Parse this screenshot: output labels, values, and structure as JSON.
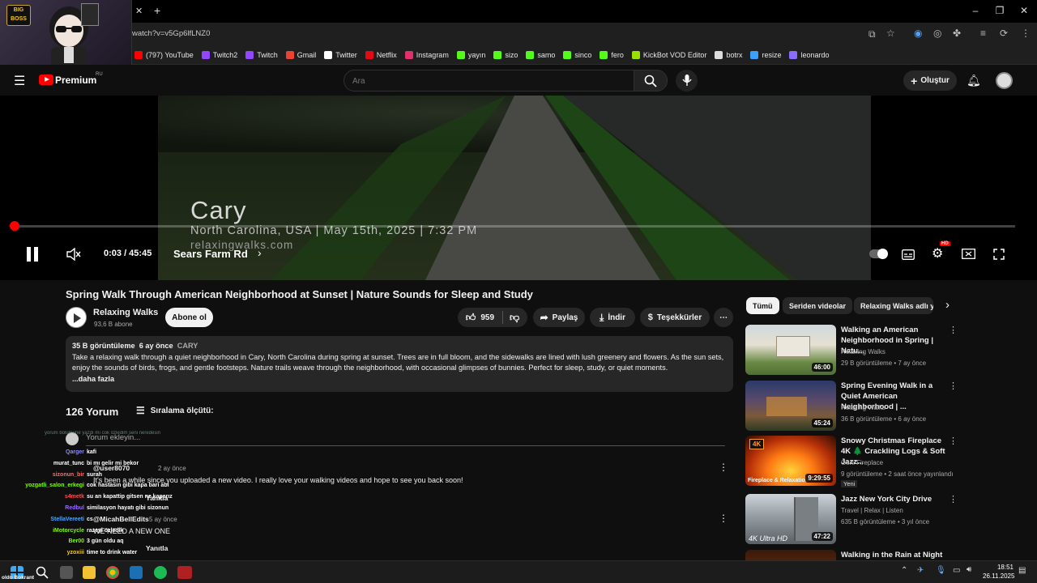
{
  "browser": {
    "url": "watch?v=v5Gp6lfLNZ0",
    "bookmarks": [
      "(797) YouTube",
      "Twitch2",
      "Twitch",
      "Gmail",
      "Twitter",
      "Netflix",
      "Instagram",
      "yayın",
      "sizo",
      "samo",
      "sinco",
      "fero",
      "KickBot VOD Editor",
      "botrx",
      "resize",
      "leonardo"
    ]
  },
  "webcam": {
    "badge_top": "BIG",
    "badge_bottom": "BOSS"
  },
  "header": {
    "logo": "Premium",
    "region": "RU",
    "search_placeholder": "Ara",
    "create_label": "Oluştur"
  },
  "player": {
    "overlay_title": "Cary",
    "overlay_subtitle": "North Carolina, USA | May 15th, 2025 | 7:32 PM",
    "overlay_site": "relaxingwalks.com",
    "time": "0:03 / 45:45",
    "chapter": "Sears Farm Rd",
    "progress": 0.001,
    "hd_badge": "HD"
  },
  "video": {
    "title": "Spring Walk Through American Neighborhood at Sunset | Nature Sounds for Sleep and Study",
    "channel": "Relaxing Walks",
    "subscribers": "93,6 B abone",
    "subscribe_label": "Abone ol",
    "likes": "959",
    "share_label": "Paylaş",
    "download_label": "İndir",
    "thanks_label": "Teşekkürler",
    "views": "35 B görüntüleme",
    "age": "6 ay önce",
    "tag": "CARY",
    "description": "Take a relaxing walk through a quiet neighborhood in Cary, North Carolina during spring at sunset. Trees are in full bloom, and the sidewalks are lined with lush greenery and flowers. As the sun sets, enjoy the sounds of birds, frogs, and gentle footsteps. Nature trails weave through the neighborhood, with occasional glimpses of bunnies. Perfect for sleep, study, or quiet moments.",
    "more_label": "...daha fazla"
  },
  "comments": {
    "count_label": "126 Yorum",
    "sort_label": "Sıralama ölçütü:",
    "add_placeholder": "Yorum ekleyin...",
    "reply_label": "Yanıtla",
    "items": [
      {
        "author": "@user8070",
        "age": "2 ay önce",
        "text": "It's been a while since you uploaded a new video. I really love your walking videos and hope to see you back soon!"
      },
      {
        "author": "@MicahBellEdits",
        "age": "5 ay önce",
        "text": "WE NEED A NEW ONE"
      }
    ]
  },
  "sidebar": {
    "chips": [
      "Tümü",
      "Seriden videolar",
      "Relaxing Walks adlı y"
    ],
    "new_label": "Yeni",
    "items": [
      {
        "title": "Walking an American Neighborhood in Spring | Natu...",
        "channel": "Relaxing Walks",
        "meta": "29 B görüntüleme • 7 ay önce",
        "duration": "46:00"
      },
      {
        "title": "Spring Evening Walk in a Quiet American Neighborhood | ...",
        "channel": "Relaxing Walks",
        "meta": "36 B görüntüleme • 6 ay önce",
        "duration": "45:24"
      },
      {
        "title": "Snowy Christmas Fireplace 4K 🌲 Crackling Logs & Soft Jazz...",
        "channel": "Geni Fireplace",
        "meta": "9 görüntüleme • 2 saat önce yayınlandı",
        "duration": "9:29:55",
        "thumb_text": "Fireplace & Relaxation"
      },
      {
        "title": "Jazz New York City Drive",
        "channel": "Travel | Relax | Listen",
        "meta": "635 B görüntüleme • 3 yıl önce",
        "duration": "47:22",
        "thumb_text": "4K Ultra HD"
      },
      {
        "title": "Walking in the Rain at Night in",
        "channel": "",
        "meta": "",
        "duration": ""
      }
    ]
  },
  "chat": [
    {
      "user": "Qarger",
      "msg": "kafi",
      "color": "#8a8aff"
    },
    {
      "user": "murat_tunc",
      "msg": "bi mı gelir mi bekor",
      "color": "#ffffff"
    },
    {
      "user": "sizonun_bir",
      "msg": "surah",
      "color": "#ff6b6b"
    },
    {
      "user": "yozgatli_salon_erkegi",
      "msg": "cok hastasın gibi kapa bari abi",
      "color": "#7fff00"
    },
    {
      "user": "s4metk",
      "msg": "su an kapattip gitsen ne kaparız",
      "color": "#ff4d4d"
    },
    {
      "user": "Redbul",
      "msg": "similasyon hayatı gibi sizonun",
      "color": "#9c6bff"
    },
    {
      "user": "StellaVereeti",
      "msg": "cs",
      "color": "#4da6ff"
    },
    {
      "user": "iMotorcycle",
      "msg": "razeyi özledik",
      "color": "#7fff00"
    },
    {
      "user": "Ber00",
      "msg": "3 gün oldu aq",
      "color": "#7fff00"
    },
    {
      "user": "yzoxiii",
      "msg": "time to drink water",
      "color": "#ffcc00"
    }
  ],
  "chat_header": "yorum bölümüne yazdı mı cok özledim seni neredesin",
  "taskbar": {
    "time": "18:51",
    "date": "26.11.2025",
    "corner_label": "oldu Bokrant"
  }
}
